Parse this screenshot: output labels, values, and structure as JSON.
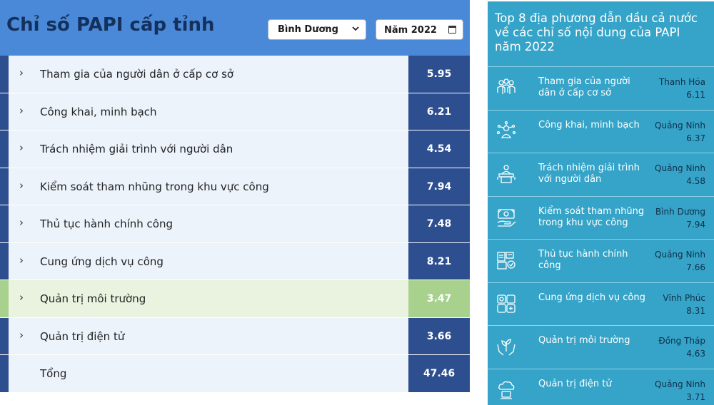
{
  "left": {
    "title": "Chỉ số PAPI cấp tỉnh",
    "province_select": "Bình Dương",
    "year_select": "Năm 2022",
    "rows": [
      {
        "label": "Tham gia của người dân ở cấp cơ sở",
        "value": "5.95",
        "chevron": "›"
      },
      {
        "label": "Công khai, minh bạch",
        "value": "6.21",
        "chevron": "›"
      },
      {
        "label": "Trách nhiệm giải trình với người dân",
        "value": "4.54",
        "chevron": "›"
      },
      {
        "label": "Kiểm soát tham nhũng trong khu vực công",
        "value": "7.94",
        "chevron": "›"
      },
      {
        "label": "Thủ tục hành chính công",
        "value": "7.48",
        "chevron": "›"
      },
      {
        "label": "Cung ứng dịch vụ công",
        "value": "8.21",
        "chevron": "›"
      },
      {
        "label": "Quản trị môi trường",
        "value": "3.47",
        "chevron": "›"
      },
      {
        "label": "Quản trị điện tử",
        "value": "3.66",
        "chevron": "›"
      },
      {
        "label": "Tổng",
        "value": "47.46",
        "chevron": ""
      }
    ],
    "highlight_index": 6,
    "colors": {
      "header": "#4a89d8",
      "value_bg": "#2d4e8f",
      "highlight": "#a9d18e",
      "row_bg": "#edf3fb"
    }
  },
  "right": {
    "title": "Top 8 địa phương dẫn dầu cả nước về các chỉ số nội dung của PAPI năm 2022",
    "items": [
      {
        "label": "Tham gia của người dân ở cấp cơ sở",
        "province": "Thanh Hóa",
        "value": "6.11",
        "icon": "people-group-icon"
      },
      {
        "label": "Công khai, minh bạch",
        "province": "Quảng Ninh",
        "value": "6.37",
        "icon": "person-network-icon"
      },
      {
        "label": "Trách nhiệm giải trình với người dân",
        "province": "Quảng Ninh",
        "value": "4.58",
        "icon": "speaker-podium-icon"
      },
      {
        "label": "Kiểm soát tham nhũng trong khu vực công",
        "province": "Bình Dương",
        "value": "7.94",
        "icon": "money-hand-icon"
      },
      {
        "label": "Thủ tục hành chính công",
        "province": "Quảng Ninh",
        "value": "7.66",
        "icon": "documents-check-icon"
      },
      {
        "label": "Cung ứng dịch vụ công",
        "province": "Vĩnh Phúc",
        "value": "8.31",
        "icon": "service-boxes-icon"
      },
      {
        "label": "Quản trị môi trường",
        "province": "Đồng Tháp",
        "value": "4.63",
        "icon": "plant-hands-icon"
      },
      {
        "label": "Quản trị điện tử",
        "province": "Quảng Ninh",
        "value": "3.71",
        "icon": "cloud-device-icon"
      }
    ],
    "colors": {
      "panel": "#36a4c8",
      "text": "#ffffff",
      "province": "#0f2f4a"
    }
  }
}
